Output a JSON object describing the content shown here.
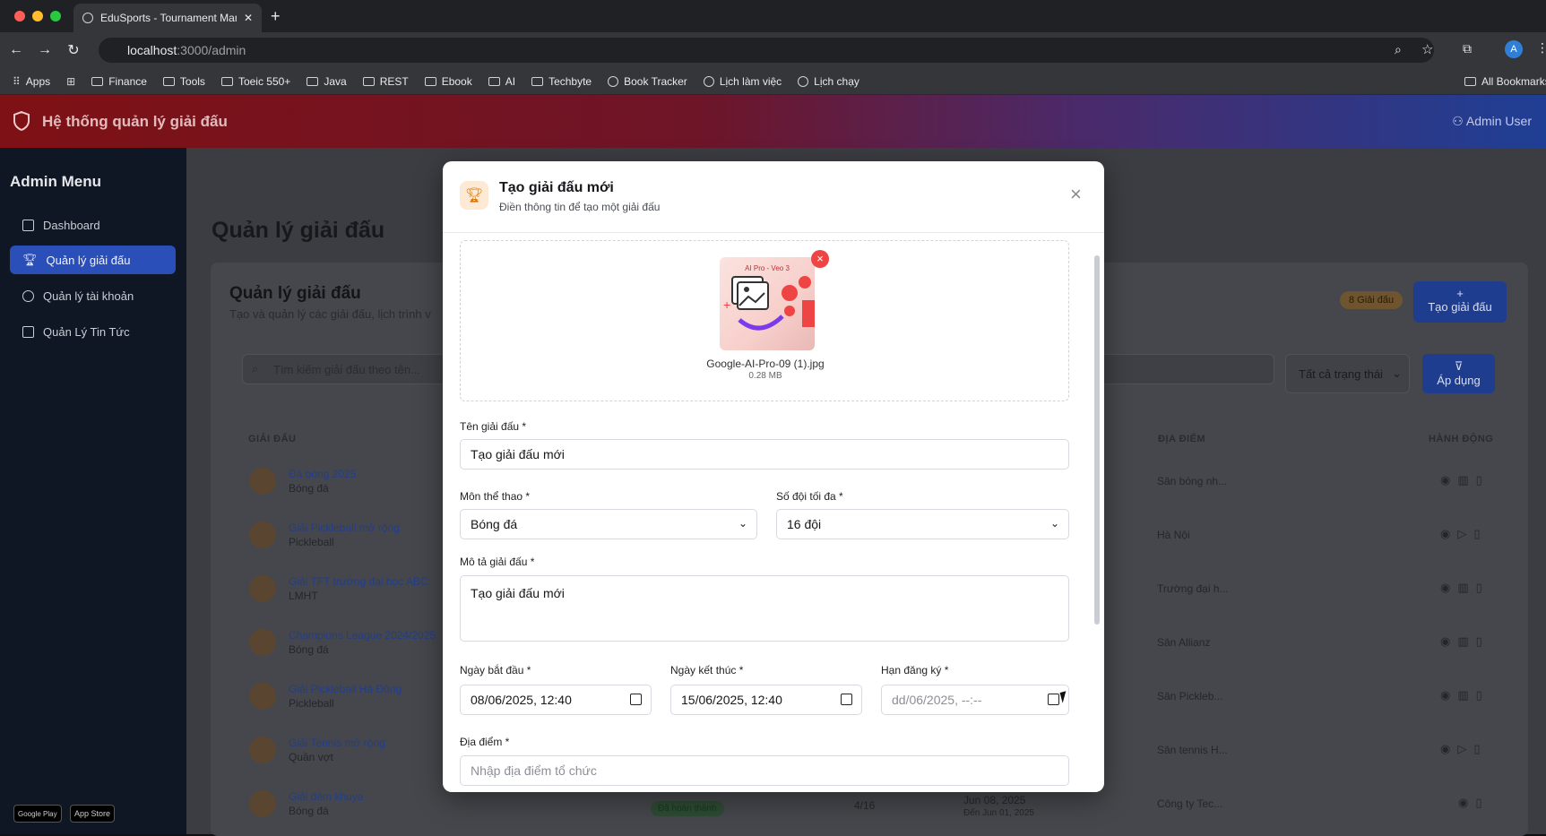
{
  "browser": {
    "tab_title": "EduSports - Tournament Man",
    "url_host": "localhost",
    "url_path": ":3000/admin",
    "bookmarks": [
      "Apps",
      "Finance",
      "Tools",
      "Toeic 550+",
      "Java",
      "REST",
      "Ebook",
      "AI",
      "Techbyte",
      "Book Tracker",
      "Lịch làm việc",
      "Lịch chạy"
    ],
    "all_bookmarks": "All Bookmarks",
    "profile_initial": "A"
  },
  "header": {
    "title": "Hệ thống quản lý giải đấu",
    "user": "Admin User"
  },
  "sidebar": {
    "title": "Admin Menu",
    "items": [
      {
        "label": "Dashboard"
      },
      {
        "label": "Quản lý giải đấu"
      },
      {
        "label": "Quản lý tài khoản"
      },
      {
        "label": "Quản Lý Tin Tức"
      }
    ],
    "google_play": "Google Play",
    "app_store": "App Store"
  },
  "main": {
    "page_title": "Quản lý giải đấu",
    "card_title": "Quản lý giải đấu",
    "card_sub": "Tạo và quản lý các giải đấu, lịch trình v",
    "count_badge": "8 Giải đấu",
    "create_button": "Tạo giải đấu",
    "search_placeholder": "Tìm kiếm giải đấu theo tên...",
    "status_filter": "Tất cả trạng thái",
    "apply_button": "Áp dụng",
    "columns": {
      "name": "GIẢI ĐẤU",
      "location": "ĐỊA ĐIỂM",
      "actions": "HÀNH ĐỘNG"
    },
    "rows": [
      {
        "name": "Đá bóng 2025",
        "sport": "Bóng đá",
        "location": "Sân bóng nh..."
      },
      {
        "name": "Giải Pickleball mở rộng",
        "sport": "Pickleball",
        "location": "Hà Nội"
      },
      {
        "name": "Giải TFT trường đại học ABC",
        "sport": "LMHT",
        "location": "Trường đại h..."
      },
      {
        "name": "Champions League 2024/2025",
        "sport": "Bóng đá",
        "location": "Sân Allianz"
      },
      {
        "name": "Giải Pickleball Hà Đông",
        "sport": "Pickleball",
        "location": "Sân Pickleb..."
      },
      {
        "name": "Giải Tennis mở rộng",
        "sport": "Quần vợt",
        "location": "Sân tennis H..."
      },
      {
        "name": "Giải đêm khuya",
        "sport": "Bóng đá",
        "location": "Công ty Tec...",
        "status": "Đã hoàn thành",
        "teams": "4/16",
        "date": "Jun 08, 2025",
        "reg": "Đến Jun 01, 2025"
      }
    ]
  },
  "modal": {
    "title": "Tạo giải đấu mới",
    "subtitle": "Điền thông tin để tạo một giải đấu",
    "image_caption": "AI Pro - Veo 3",
    "file_name": "Google-AI-Pro-09 (1).jpg",
    "file_size": "0.28 MB",
    "name_label": "Tên giải đấu *",
    "name_value": "Tạo giải đấu mới",
    "sport_label": "Môn thể thao *",
    "sport_value": "Bóng đá",
    "teams_label": "Số đội tối đa *",
    "teams_value": "16 đội",
    "desc_label": "Mô tả giải đấu *",
    "desc_value": "Tạo giải đấu mới",
    "start_label": "Ngày bắt đầu *",
    "start_value": "08/06/2025, 12:40",
    "end_label": "Ngày kết thúc *",
    "end_value": "15/06/2025, 12:40",
    "deadline_label": "Hạn đăng ký *",
    "deadline_value": "dd/06/2025, --:--",
    "location_label": "Địa điểm *",
    "location_placeholder": "Nhập địa điểm tổ chức"
  },
  "colors": {
    "primary": "#2b4fb8",
    "danger": "#ef4444",
    "header_start": "#7e1115",
    "header_end": "#1f3f95"
  }
}
